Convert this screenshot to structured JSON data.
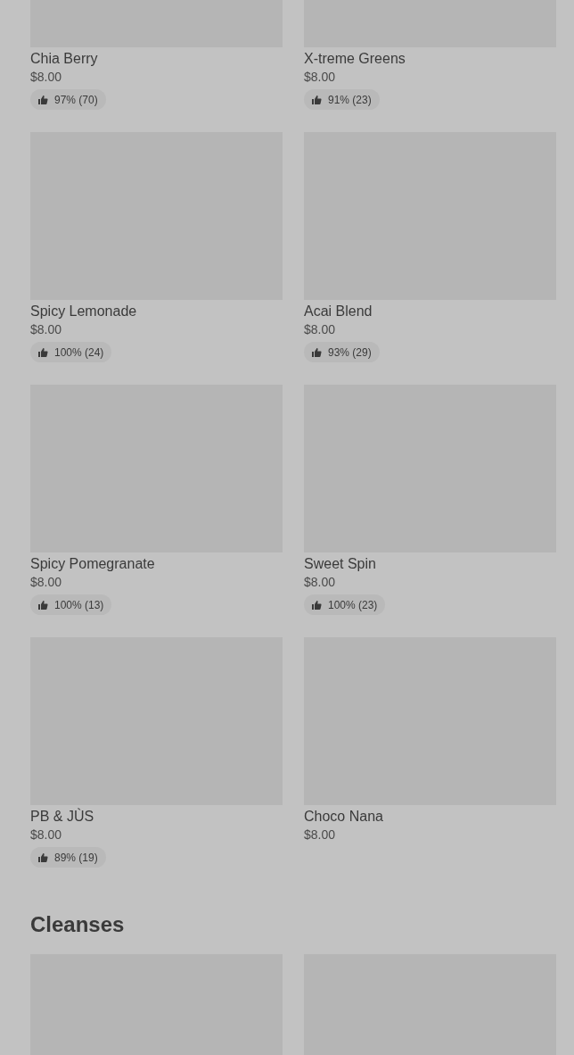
{
  "products": [
    {
      "name": "Chia Berry",
      "price": "$8.00",
      "rating": "97% (70)"
    },
    {
      "name": "X-treme Greens",
      "price": "$8.00",
      "rating": "91% (23)"
    },
    {
      "name": "Spicy Lemonade",
      "price": "$8.00",
      "rating": "100% (24)"
    },
    {
      "name": "Acai Blend",
      "price": "$8.00",
      "rating": "93% (29)"
    },
    {
      "name": "Spicy Pomegranate",
      "price": "$8.00",
      "rating": "100% (13)"
    },
    {
      "name": "Sweet Spin",
      "price": "$8.00",
      "rating": "100% (23)"
    },
    {
      "name": "PB & JÙS",
      "price": "$8.00",
      "rating": "89% (19)"
    },
    {
      "name": "Choco Nana",
      "price": "$8.00"
    }
  ],
  "sections": [
    {
      "title": "Cleanses"
    }
  ]
}
